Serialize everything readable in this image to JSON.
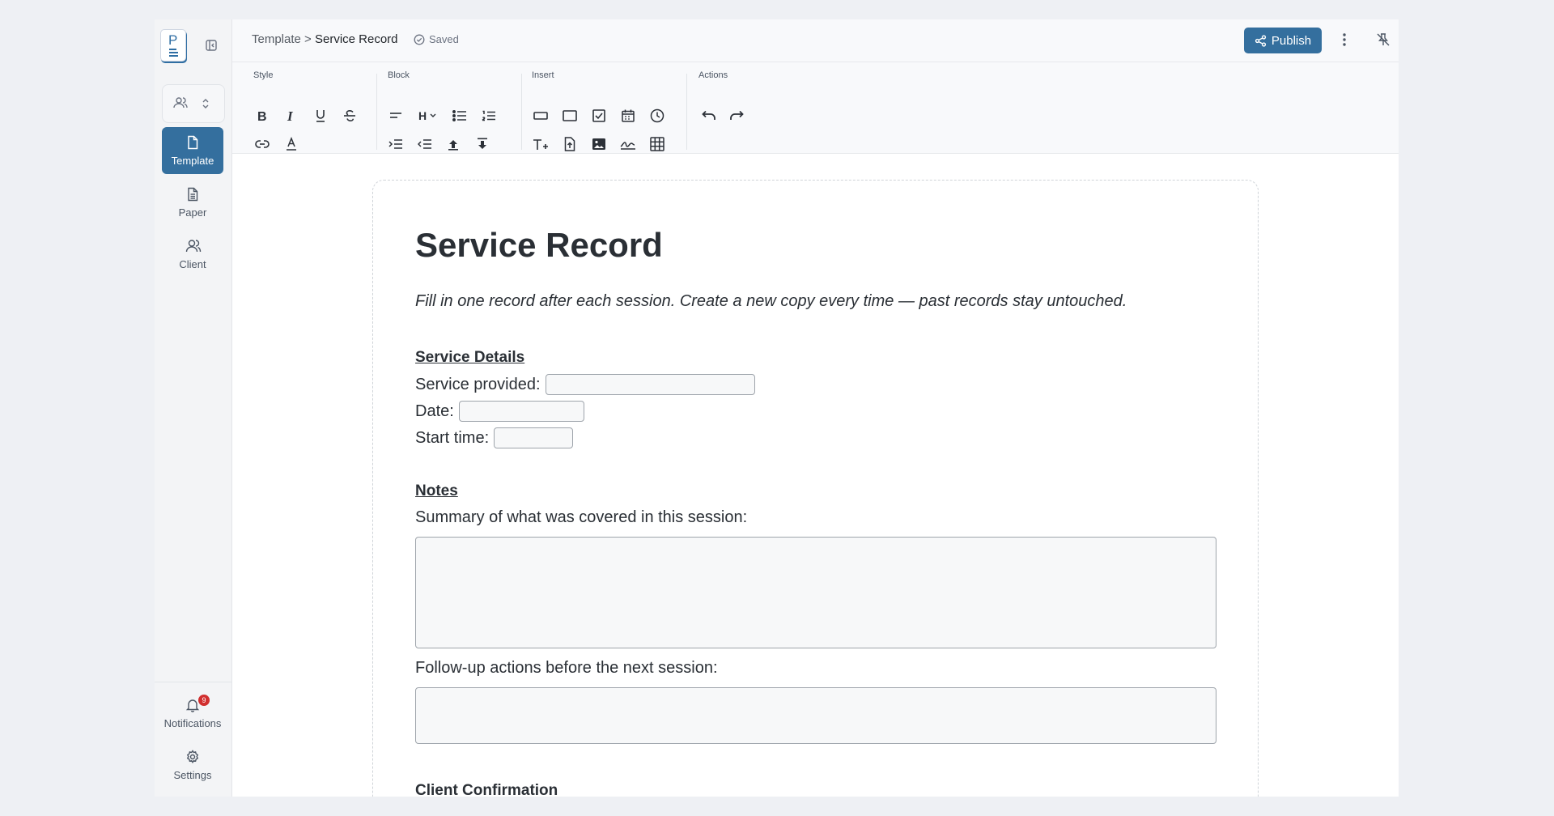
{
  "sidebar": {
    "nav": [
      {
        "label": "Template",
        "icon": "document-icon",
        "active": true
      },
      {
        "label": "Paper",
        "icon": "paper-icon",
        "active": false
      },
      {
        "label": "Client",
        "icon": "users-icon",
        "active": false
      }
    ],
    "bottom": [
      {
        "label": "Notifications",
        "icon": "bell-icon",
        "badge": "9"
      },
      {
        "label": "Settings",
        "icon": "gear-icon"
      }
    ]
  },
  "header": {
    "breadcrumb_root": "Template",
    "breadcrumb_sep": ">",
    "breadcrumb_current": "Service Record",
    "status": "Saved",
    "publish_label": "Publish"
  },
  "toolbar": {
    "groups": {
      "style": "Style",
      "block": "Block",
      "insert": "Insert",
      "actions": "Actions"
    },
    "heading_glyph": "H"
  },
  "document": {
    "title": "Service Record",
    "intro": "Fill in one record after each session. Create a new copy every time — past records stay untouched.",
    "sections": {
      "details": {
        "heading": "Service Details",
        "fields": {
          "service": "Service provided:",
          "date": "Date:",
          "start": "Start time:"
        }
      },
      "notes": {
        "heading": "Notes",
        "summary_label": "Summary of what was covered in this session:",
        "followup_label": "Follow-up actions before the next session:"
      },
      "confirmation": {
        "heading": "Client Confirmation"
      }
    }
  },
  "colors": {
    "accent": "#346f9e",
    "badge": "#d12f2f"
  }
}
